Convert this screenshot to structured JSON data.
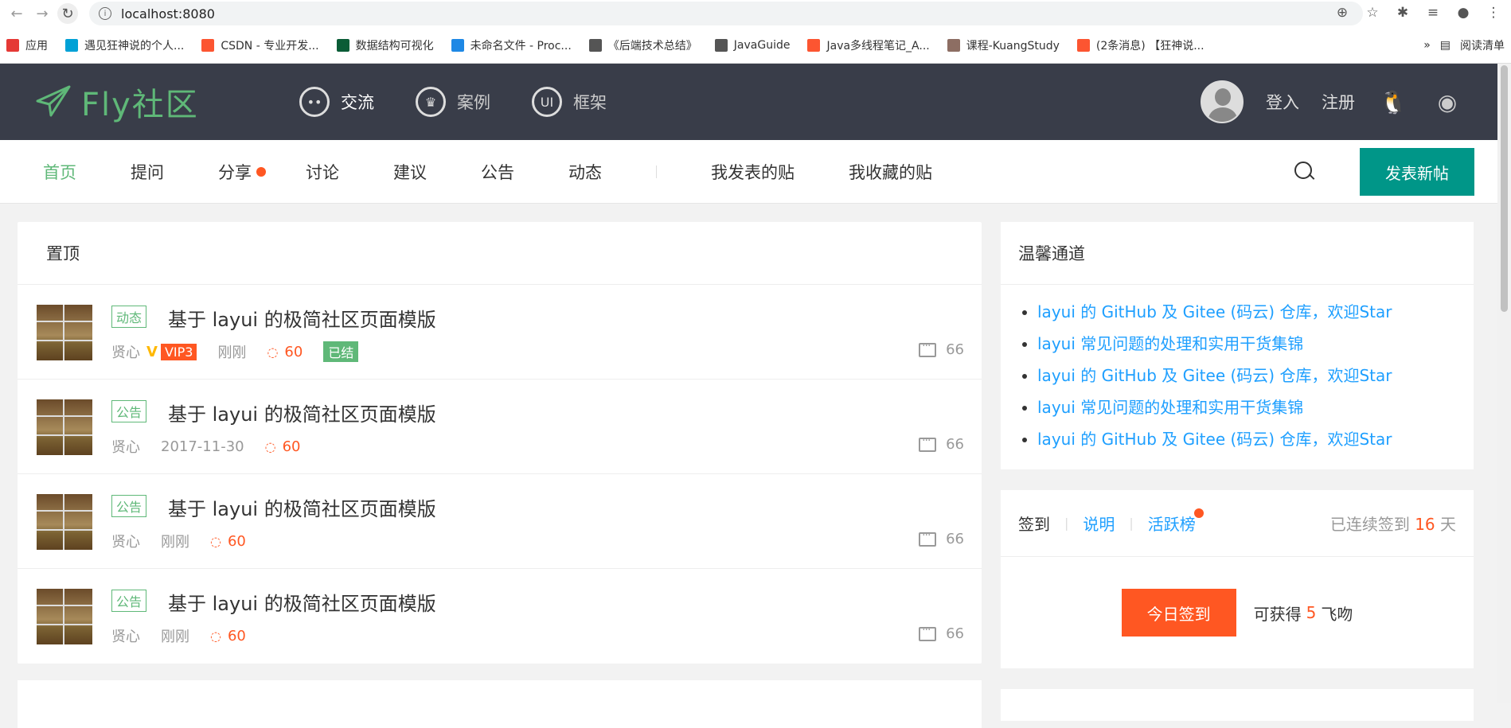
{
  "browser": {
    "url": "localhost:8080",
    "bookmarks": [
      {
        "label": "应用",
        "icon": "apps-grid-icon",
        "color": "#e53935"
      },
      {
        "label": "遇见狂神说的个人...",
        "icon": "bilibili-icon",
        "color": "#00a1d6"
      },
      {
        "label": "CSDN - 专业开发...",
        "icon": "csdn-icon",
        "color": "#fc5531"
      },
      {
        "label": "数据结构可视化",
        "icon": "usf-icon",
        "color": "#0a5c36"
      },
      {
        "label": "未命名文件 - Proc...",
        "icon": "processon-icon",
        "color": "#1e88e5"
      },
      {
        "label": "《后端技术总结》",
        "icon": "globe-icon",
        "color": "#555555"
      },
      {
        "label": "JavaGuide",
        "icon": "globe-icon",
        "color": "#555555"
      },
      {
        "label": "Java多线程笔记_A...",
        "icon": "csdn-icon",
        "color": "#fc5531"
      },
      {
        "label": "课程-KuangStudy",
        "icon": "kuang-icon",
        "color": "#8d6e63"
      },
      {
        "label": "(2条消息) 【狂神说...",
        "icon": "csdn-icon",
        "color": "#fc5531"
      }
    ],
    "more": "»",
    "reading_list": "阅读清单"
  },
  "header": {
    "logo_text": "Fly社区",
    "nav": [
      {
        "label": "交流",
        "icon": "chat-icon"
      },
      {
        "label": "案例",
        "icon": "crown-icon"
      },
      {
        "label": "框架",
        "icon": "ui-icon"
      }
    ],
    "login": "登入",
    "register": "注册"
  },
  "subnav": {
    "items": [
      "首页",
      "提问",
      "分享",
      "讨论",
      "建议",
      "公告",
      "动态"
    ],
    "my_posts": "我发表的贴",
    "my_favorites": "我收藏的贴",
    "new_post": "发表新帖"
  },
  "top_panel": {
    "title": "置顶",
    "posts": [
      {
        "tag": "动态",
        "title": "基于 layui 的极简社区页面模版",
        "author": "贤心",
        "vip": "VIP3",
        "time": "刚刚",
        "likes": "60",
        "status": "已结",
        "comments": "66"
      },
      {
        "tag": "公告",
        "title": "基于 layui 的极简社区页面模版",
        "author": "贤心",
        "time": "2017-11-30",
        "likes": "60",
        "comments": "66"
      },
      {
        "tag": "公告",
        "title": "基于 layui 的极简社区页面模版",
        "author": "贤心",
        "time": "刚刚",
        "likes": "60",
        "comments": "66"
      },
      {
        "tag": "公告",
        "title": "基于 layui 的极简社区页面模版",
        "author": "贤心",
        "time": "刚刚",
        "likes": "60",
        "comments": "66"
      }
    ]
  },
  "sidebar": {
    "channel_title": "温馨通道",
    "channel_links": [
      "layui 的 GitHub 及 Gitee (码云) 仓库，欢迎Star",
      "layui 常见问题的处理和实用干货集锦",
      "layui 的 GitHub 及 Gitee (码云) 仓库，欢迎Star",
      "layui 常见问题的处理和实用干货集锦",
      "layui 的 GitHub 及 Gitee (码云) 仓库，欢迎Star"
    ],
    "sign": {
      "label": "签到",
      "explain": "说明",
      "ranking": "活跃榜",
      "streak_prefix": "已连续签到",
      "streak_days": "16",
      "streak_suffix": "天",
      "button": "今日签到",
      "reward_prefix": "可获得",
      "reward_value": "5",
      "reward_suffix": "飞吻"
    }
  }
}
